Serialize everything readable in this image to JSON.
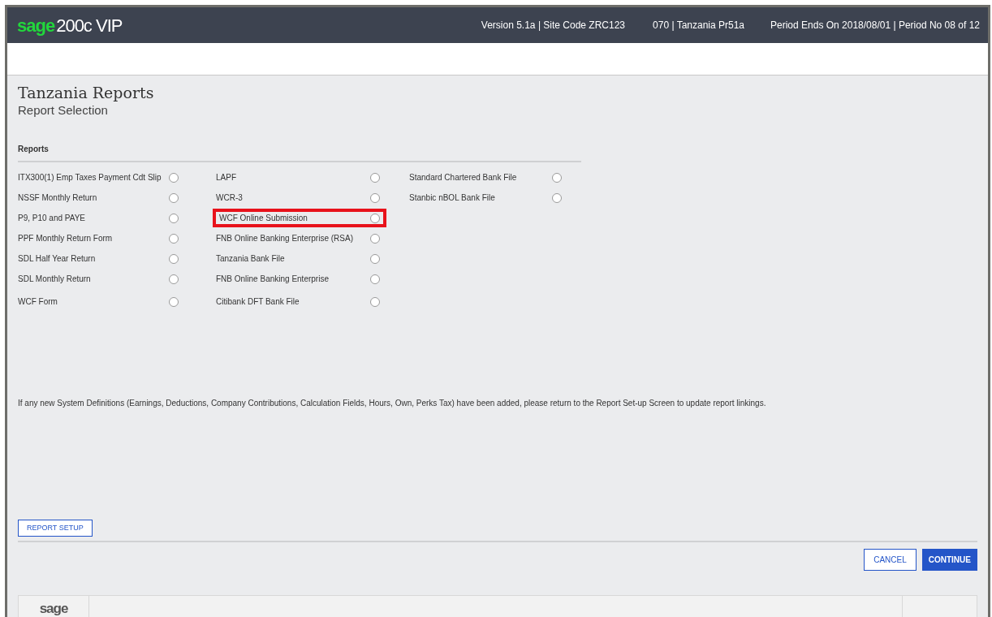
{
  "header": {
    "logo_brand": "sage",
    "logo_product": "200c VIP",
    "version": "Version 5.1a | Site Code ZRC123",
    "company": "070 | Tanzania Pr51a",
    "period": "Period Ends On 2018/08/01 | Period No 08 of 12"
  },
  "page": {
    "title": "Tanzania Reports",
    "subtitle": "Report Selection"
  },
  "reports": {
    "heading": "Reports",
    "columns": [
      [
        {
          "label": "ITX300(1) Emp Taxes Payment Cdt Slip",
          "selected": false,
          "highlighted": false
        },
        {
          "label": "NSSF Monthly Return",
          "selected": false,
          "highlighted": false
        },
        {
          "label": "P9, P10 and PAYE",
          "selected": false,
          "highlighted": false
        },
        {
          "label": "PPF Monthly Return Form",
          "selected": false,
          "highlighted": false
        },
        {
          "label": "SDL Half Year Return",
          "selected": false,
          "highlighted": false
        },
        {
          "label": "SDL Monthly Return",
          "selected": false,
          "highlighted": false
        },
        {
          "label": "WCF Form",
          "selected": false,
          "highlighted": false
        }
      ],
      [
        {
          "label": "LAPF",
          "selected": false,
          "highlighted": false
        },
        {
          "label": "WCR-3",
          "selected": false,
          "highlighted": false
        },
        {
          "label": "WCF Online Submission",
          "selected": false,
          "highlighted": true
        },
        {
          "label": "FNB Online Banking Enterprise (RSA)",
          "selected": false,
          "highlighted": false
        },
        {
          "label": "Tanzania Bank File",
          "selected": false,
          "highlighted": false
        },
        {
          "label": "FNB Online Banking Enterprise",
          "selected": false,
          "highlighted": false
        },
        {
          "label": "Citibank DFT Bank File",
          "selected": false,
          "highlighted": false
        }
      ],
      [
        {
          "label": "Standard Chartered Bank File",
          "selected": false,
          "highlighted": false
        },
        {
          "label": "Stanbic nBOL Bank File",
          "selected": false,
          "highlighted": false
        }
      ]
    ]
  },
  "message": "If any new System Definitions (Earnings, Deductions, Company Contributions, Calculation Fields, Hours, Own, Perks Tax) have been added, please return to the Report Set-up Screen to update report linkings.",
  "buttons": {
    "report_setup": "REPORT SETUP",
    "cancel": "CANCEL",
    "continue": "CONTINUE"
  },
  "footer": {
    "logo": "sage"
  }
}
